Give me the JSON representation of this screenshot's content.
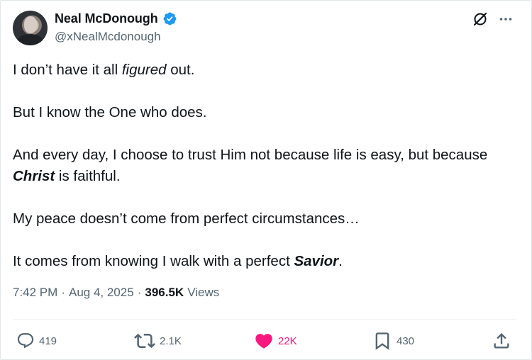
{
  "author": {
    "name": "Neal McDonough",
    "handle": "@xNealMcdonough",
    "verified": true,
    "avatar_icon": "avatar-photo"
  },
  "header_icons": [
    "grok-icon",
    "more-icon"
  ],
  "tweet": {
    "paragraphs": [
      [
        {
          "text": "I don’t have it all "
        },
        {
          "text": "figured",
          "style": "italic"
        },
        {
          "text": " out."
        }
      ],
      [
        {
          "text": "But I know the One who does."
        }
      ],
      [
        {
          "text": "And every day, I choose to trust Him not because life is easy, but because "
        },
        {
          "text": "Christ",
          "style": "bold-italic"
        },
        {
          "text": " is faithful."
        }
      ],
      [
        {
          "text": "My peace doesn’t come from perfect circumstances…"
        }
      ],
      [
        {
          "text": "It comes from knowing I walk with a perfect "
        },
        {
          "text": "Savior",
          "style": "bold-italic"
        },
        {
          "text": "."
        }
      ]
    ]
  },
  "meta": {
    "time": "7:42 PM",
    "separator": "·",
    "date": "Aug 4, 2025",
    "views_count": "396.5K",
    "views_label": "Views"
  },
  "actions": {
    "replies": "419",
    "reposts": "2.1K",
    "likes": "22K",
    "bookmarks": "430"
  },
  "colors": {
    "text": "#0f1419",
    "secondary": "#536471",
    "verified": "#1d9bf0",
    "like": "#f91880",
    "divider": "#eff3f4"
  }
}
